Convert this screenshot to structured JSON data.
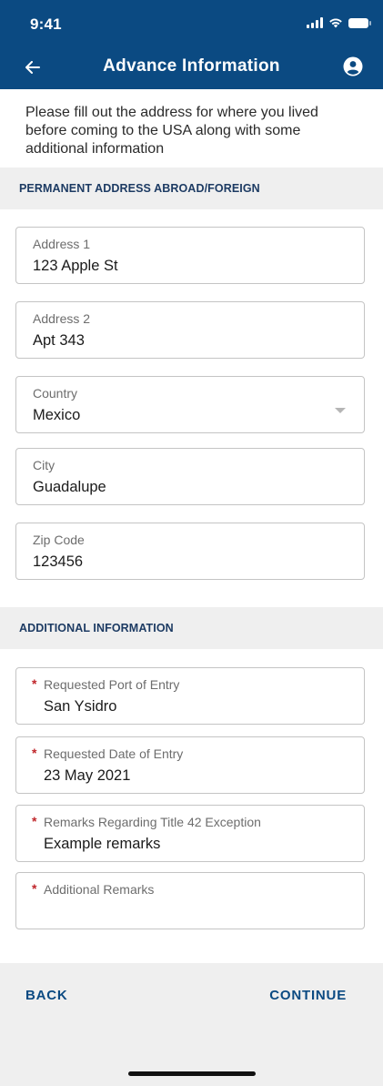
{
  "status_bar": {
    "time": "9:41"
  },
  "header": {
    "title": "Advance Information"
  },
  "intro_text": "Please fill out the address for where you lived before coming to the USA along with some additional information",
  "sections": {
    "address_header": "PERMANENT ADDRESS ABROAD/FOREIGN",
    "additional_header": "ADDITIONAL INFORMATION"
  },
  "address_fields": {
    "address1": {
      "label": "Address 1",
      "value": "123 Apple St"
    },
    "address2": {
      "label": "Address 2",
      "value": "Apt 343"
    },
    "country": {
      "label": "Country",
      "value": "Mexico"
    },
    "city": {
      "label": "City",
      "value": "Guadalupe"
    },
    "zip": {
      "label": "Zip Code",
      "value": "123456"
    }
  },
  "additional_fields": {
    "port": {
      "label": "Requested Port of Entry",
      "value": "San Ysidro",
      "required_mark": "*"
    },
    "date": {
      "label": "Requested Date of Entry",
      "value": "23 May 2021",
      "required_mark": "*"
    },
    "remarks42": {
      "label": "Remarks Regarding Title 42 Exception",
      "value": "Example remarks",
      "required_mark": "*"
    },
    "additional": {
      "label": "Additional Remarks",
      "value": "",
      "required_mark": "*"
    }
  },
  "footer": {
    "back_label": "BACK",
    "continue_label": "CONTINUE"
  },
  "colors": {
    "header_bg": "#0b4a82",
    "section_bg": "#efefef",
    "required": "#c0262b",
    "section_text": "#1d3b63"
  },
  "icons": {
    "back": "arrow-left-icon",
    "profile": "user-circle-icon",
    "caret": "chevron-down-icon"
  }
}
